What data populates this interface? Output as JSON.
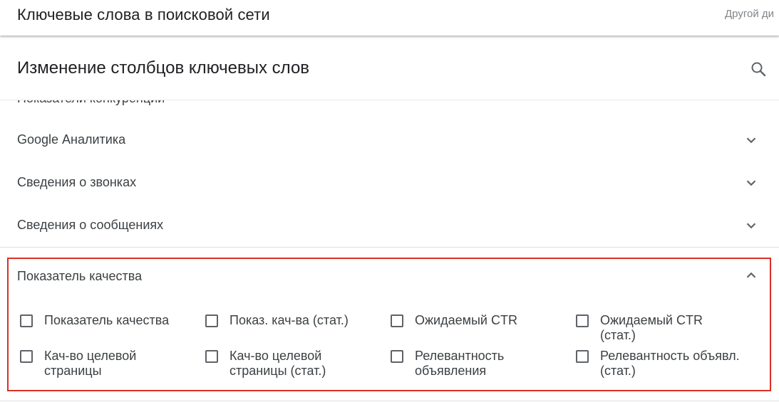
{
  "topbar": {
    "title": "Ключевые слова в поисковой сети",
    "right_text": "Другой ди"
  },
  "panel": {
    "title": "Изменение столбцов ключевых слов",
    "search_icon": "search-icon"
  },
  "sections": {
    "cut_off_label": "Показатели конкуренции",
    "collapsed": [
      {
        "label": "Google Аналитика",
        "icon": "chevron-down-icon"
      },
      {
        "label": "Сведения о звонках",
        "icon": "chevron-down-icon"
      },
      {
        "label": "Сведения о сообщениях",
        "icon": "chevron-down-icon"
      }
    ],
    "expanded": {
      "label": "Показатель качества",
      "icon": "chevron-up-icon",
      "options": [
        {
          "label": "Показатель качества",
          "checked": false
        },
        {
          "label": "Показ. кач-ва (стат.)",
          "checked": false
        },
        {
          "label": "Ожидаемый CTR",
          "checked": false
        },
        {
          "label": "Ожидаемый CTR (стат.)",
          "checked": false
        },
        {
          "label": "Кач-во целевой страницы",
          "checked": false
        },
        {
          "label": "Кач-во целевой страницы (стат.)",
          "checked": false
        },
        {
          "label": "Релевантность объявления",
          "checked": false
        },
        {
          "label": "Релевантность объявл. (стат.)",
          "checked": false
        }
      ]
    }
  },
  "colors": {
    "highlight": "#d93025",
    "text": "#3c4043",
    "muted": "#80868b"
  }
}
